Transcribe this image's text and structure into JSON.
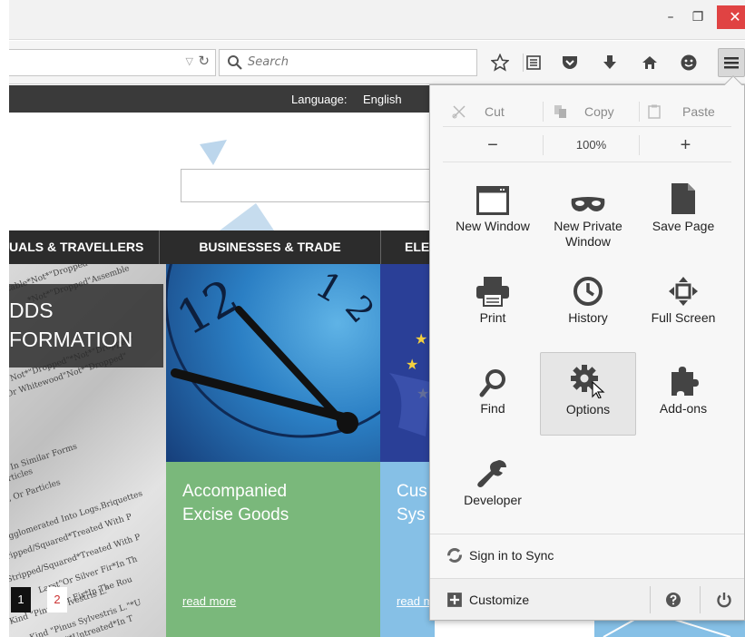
{
  "window": {
    "minimize": "–",
    "maximize": "❐",
    "close": "✕"
  },
  "toolbar": {
    "search_placeholder": "Search"
  },
  "page": {
    "language_label": "Language:",
    "language_value": "English",
    "categories": [
      "UALS & TRAVELLERS",
      "BUSINESSES & TRADE",
      "ELE"
    ],
    "goods_box_lines": [
      "DDS",
      "FORMATION"
    ],
    "paper_lines": [
      "table*Not*\"Dropped\"",
      "*Not*\"Dropped\"Assemble",
      "Not*\"Dropped\"*Not*\"Dropped\"",
      "Or Whitewood\"Not*\"Dropped\"",
      "In Similar Forms",
      "rticles",
      ", Or Particles",
      "gglomerated Into Logs,Briquettes",
      "ripped/Squared*Treated With P",
      "Stripped/Squared*Treated With P",
      "Larst\"Or Silver Fir*In Th",
      "ver Fir*In The Rou",
      "Kind \"Pinus Sylvestris L.\"",
      "Kind \"Pinus Sylvestris L.\"*U",
      "**Untreated*In T"
    ],
    "tile_green": {
      "title_line1": "Accompanied",
      "title_line2": "Excise Goods",
      "read_more": "read more"
    },
    "tile_blue": {
      "title_line1": "Cus",
      "title_line2": "Sys",
      "read_more": "read m"
    },
    "pager": [
      "1",
      "2"
    ]
  },
  "menu": {
    "edit": {
      "cut": "Cut",
      "copy": "Copy",
      "paste": "Paste"
    },
    "zoom": {
      "out": "−",
      "level": "100%",
      "in": "+"
    },
    "items": [
      {
        "label": "New Window",
        "icon": "window-icon"
      },
      {
        "label": "New Private Window",
        "icon": "mask-icon"
      },
      {
        "label": "Save Page",
        "icon": "page-icon"
      },
      {
        "label": "Print",
        "icon": "printer-icon"
      },
      {
        "label": "History",
        "icon": "clock-icon"
      },
      {
        "label": "Full Screen",
        "icon": "fullscreen-icon"
      },
      {
        "label": "Find",
        "icon": "magnifier-icon"
      },
      {
        "label": "Options",
        "icon": "gear-icon"
      },
      {
        "label": "Add-ons",
        "icon": "puzzle-icon"
      },
      {
        "label": "Developer",
        "icon": "wrench-icon"
      }
    ],
    "sign_in": "Sign in to Sync",
    "customize": "Customize"
  },
  "colors": {
    "close_button": "#e04343",
    "green_tile": "#7ab87b",
    "blue_tile": "#86c0e6",
    "clock_tile": "#2b7fc4",
    "nav_dark": "#2c2c2c",
    "pager_active": "#111111",
    "pager_link": "#cc3333"
  }
}
